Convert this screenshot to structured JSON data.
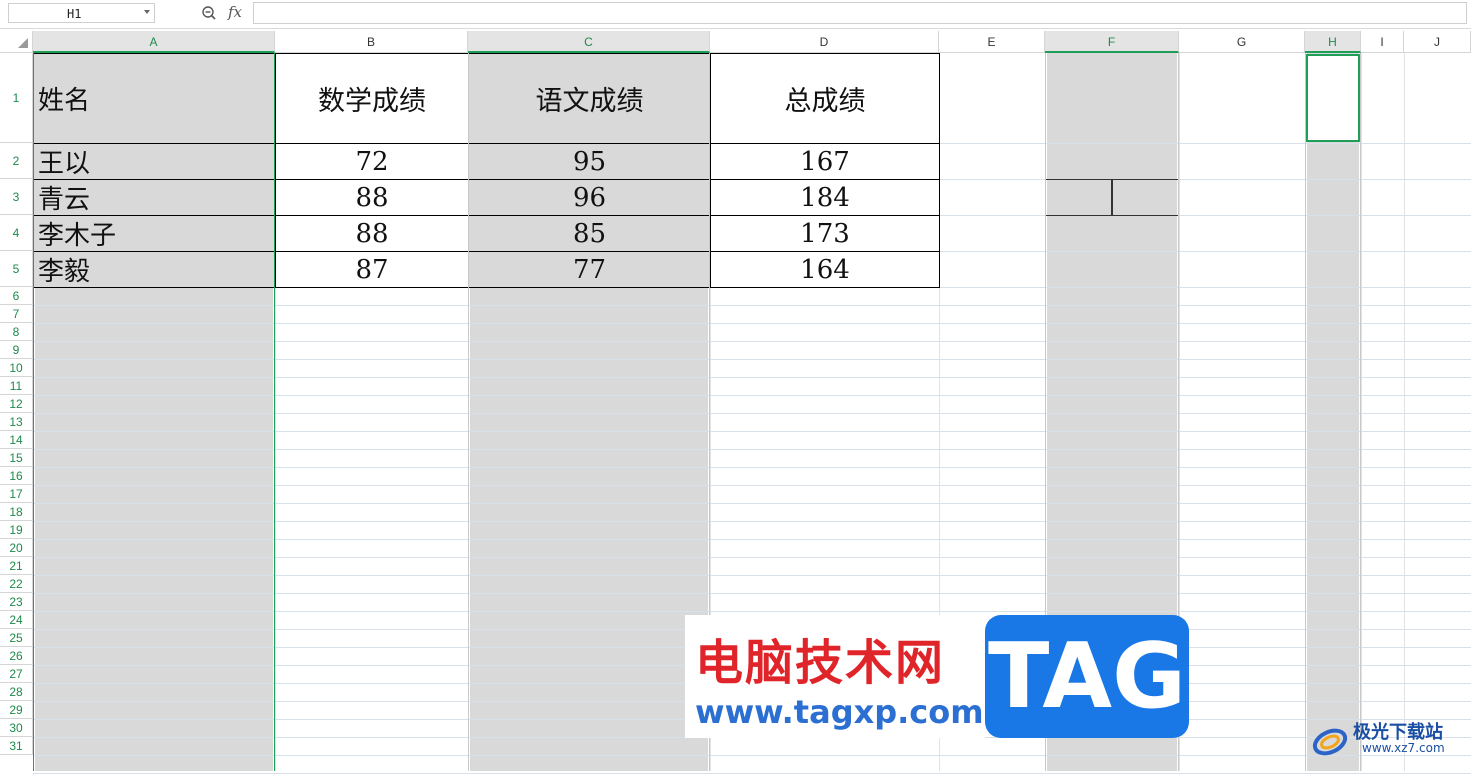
{
  "formula_bar": {
    "name_box": "H1",
    "fx_label": "fx",
    "formula_value": ""
  },
  "columns": [
    "A",
    "B",
    "C",
    "D",
    "E",
    "F",
    "G",
    "H",
    "I",
    "J"
  ],
  "rows": [
    "1",
    "2",
    "3",
    "4",
    "5",
    "6",
    "7",
    "8",
    "9",
    "10",
    "11",
    "12",
    "13",
    "14",
    "15",
    "16",
    "17",
    "18",
    "19",
    "20",
    "21",
    "22",
    "23",
    "24",
    "25",
    "26",
    "27",
    "28",
    "29",
    "30",
    "31"
  ],
  "table": {
    "headers": [
      "姓名",
      "数学成绩",
      "语文成绩",
      "总成绩"
    ],
    "rows": [
      [
        "王以",
        "72",
        "95",
        "167"
      ],
      [
        "青云",
        "88",
        "96",
        "184"
      ],
      [
        "李木子",
        "88",
        "85",
        "173"
      ],
      [
        "李毅",
        "87",
        "77",
        "164"
      ]
    ]
  },
  "watermark": {
    "title": "电脑技术网",
    "url": "www.tagxp.com",
    "tag": "TAG"
  },
  "logo2": {
    "text": "极光下载站",
    "url": "www.xz7.com"
  },
  "colors": {
    "selection_green": "#1f9e58",
    "shade": "#d9d9d9",
    "watermark_red": "#e0252a",
    "watermark_blue": "#1a78e6"
  }
}
